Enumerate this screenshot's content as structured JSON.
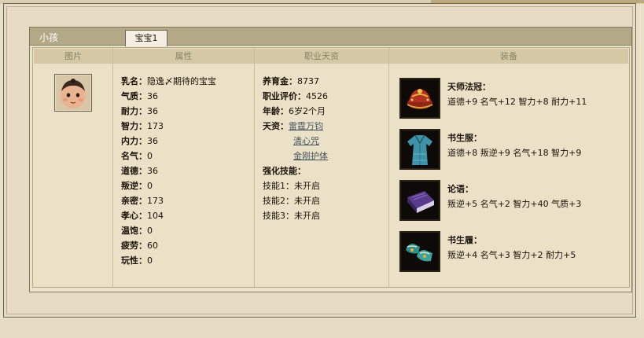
{
  "panel": {
    "title": "小孩",
    "tab": "宝宝1"
  },
  "columns": {
    "picture": "图片",
    "attributes": "属性",
    "talent": "职业天资",
    "equipment": "装备"
  },
  "attributes": [
    {
      "label": "乳名：",
      "value": "隐逸〆期待的宝宝"
    },
    {
      "label": "气质：",
      "value": "36"
    },
    {
      "label": "耐力：",
      "value": "36"
    },
    {
      "label": "智力：",
      "value": "173"
    },
    {
      "label": "内力：",
      "value": "36"
    },
    {
      "label": "名气：",
      "value": "0"
    },
    {
      "label": "道德：",
      "value": "36"
    },
    {
      "label": "叛逆：",
      "value": "0"
    },
    {
      "label": "亲密：",
      "value": "173"
    },
    {
      "label": "孝心：",
      "value": "104"
    },
    {
      "label": "温饱：",
      "value": "0"
    },
    {
      "label": "疲劳：",
      "value": "60"
    },
    {
      "label": "玩性：",
      "value": "0"
    }
  ],
  "talent": {
    "money_label": "养育金：",
    "money_value": "8737",
    "rating_label": "职业评价：",
    "rating_value": "4526",
    "age_label": "年龄：",
    "age_value": "6岁2个月",
    "gift_label": "天资：",
    "gifts": [
      "雷霆万钧",
      "清心咒",
      "金刚护体"
    ],
    "skills_label": "强化技能：",
    "skills": [
      {
        "label": "技能1：",
        "value": "未开启"
      },
      {
        "label": "技能2：",
        "value": "未开启"
      },
      {
        "label": "技能3：",
        "value": "未开启"
      }
    ]
  },
  "equipment": [
    {
      "name": "天师法冠：",
      "stats": "道德+9 名气+12 智力+8 耐力+11",
      "icon": "hat-icon"
    },
    {
      "name": "书生服：",
      "stats": "道德+8 叛逆+9 名气+18 智力+9",
      "icon": "robe-icon"
    },
    {
      "name": "论语：",
      "stats": "叛逆+5 名气+2 智力+40 气质+3",
      "icon": "book-icon"
    },
    {
      "name": "书生履：",
      "stats": "叛逆+4 名气+3 智力+2 耐力+5",
      "icon": "shoes-icon"
    }
  ]
}
